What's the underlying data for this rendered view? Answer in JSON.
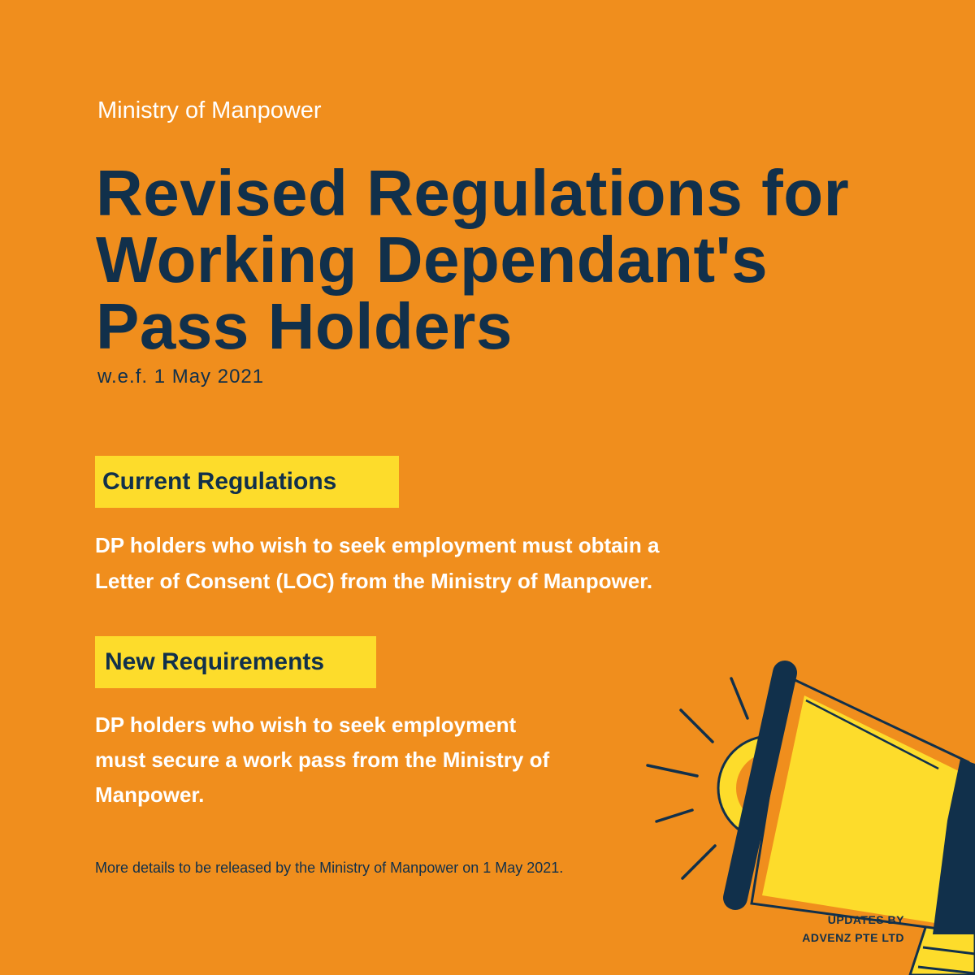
{
  "header": {
    "ministry": "Ministry of Manpower"
  },
  "title": {
    "lines": [
      "Revised Regulations for",
      "Working Dependant's",
      "Pass Holders"
    ]
  },
  "effective": "w.e.f. 1 May 2021",
  "sections": [
    {
      "heading": "Current Regulations",
      "lines": [
        "DP holders who wish to seek employment must obtain a",
        "Letter of Consent (LOC) from the Ministry of Manpower."
      ]
    },
    {
      "heading": "New Requirements",
      "lines": [
        "DP holders who wish to seek employment",
        "must secure a work pass from the Ministry of",
        "Manpower."
      ]
    }
  ],
  "footnote": "More details to be released by the Ministry of Manpower on 1 May 2021.",
  "credit": {
    "line1": "UPDATES BY",
    "line2": "ADVENZ PTE LTD"
  },
  "illustration": {
    "icon": "megaphone-icon"
  },
  "colors": {
    "background": "#F08E1D",
    "navy": "#11304B",
    "yellow": "#FDDC2B",
    "white": "#FFFFFF"
  }
}
